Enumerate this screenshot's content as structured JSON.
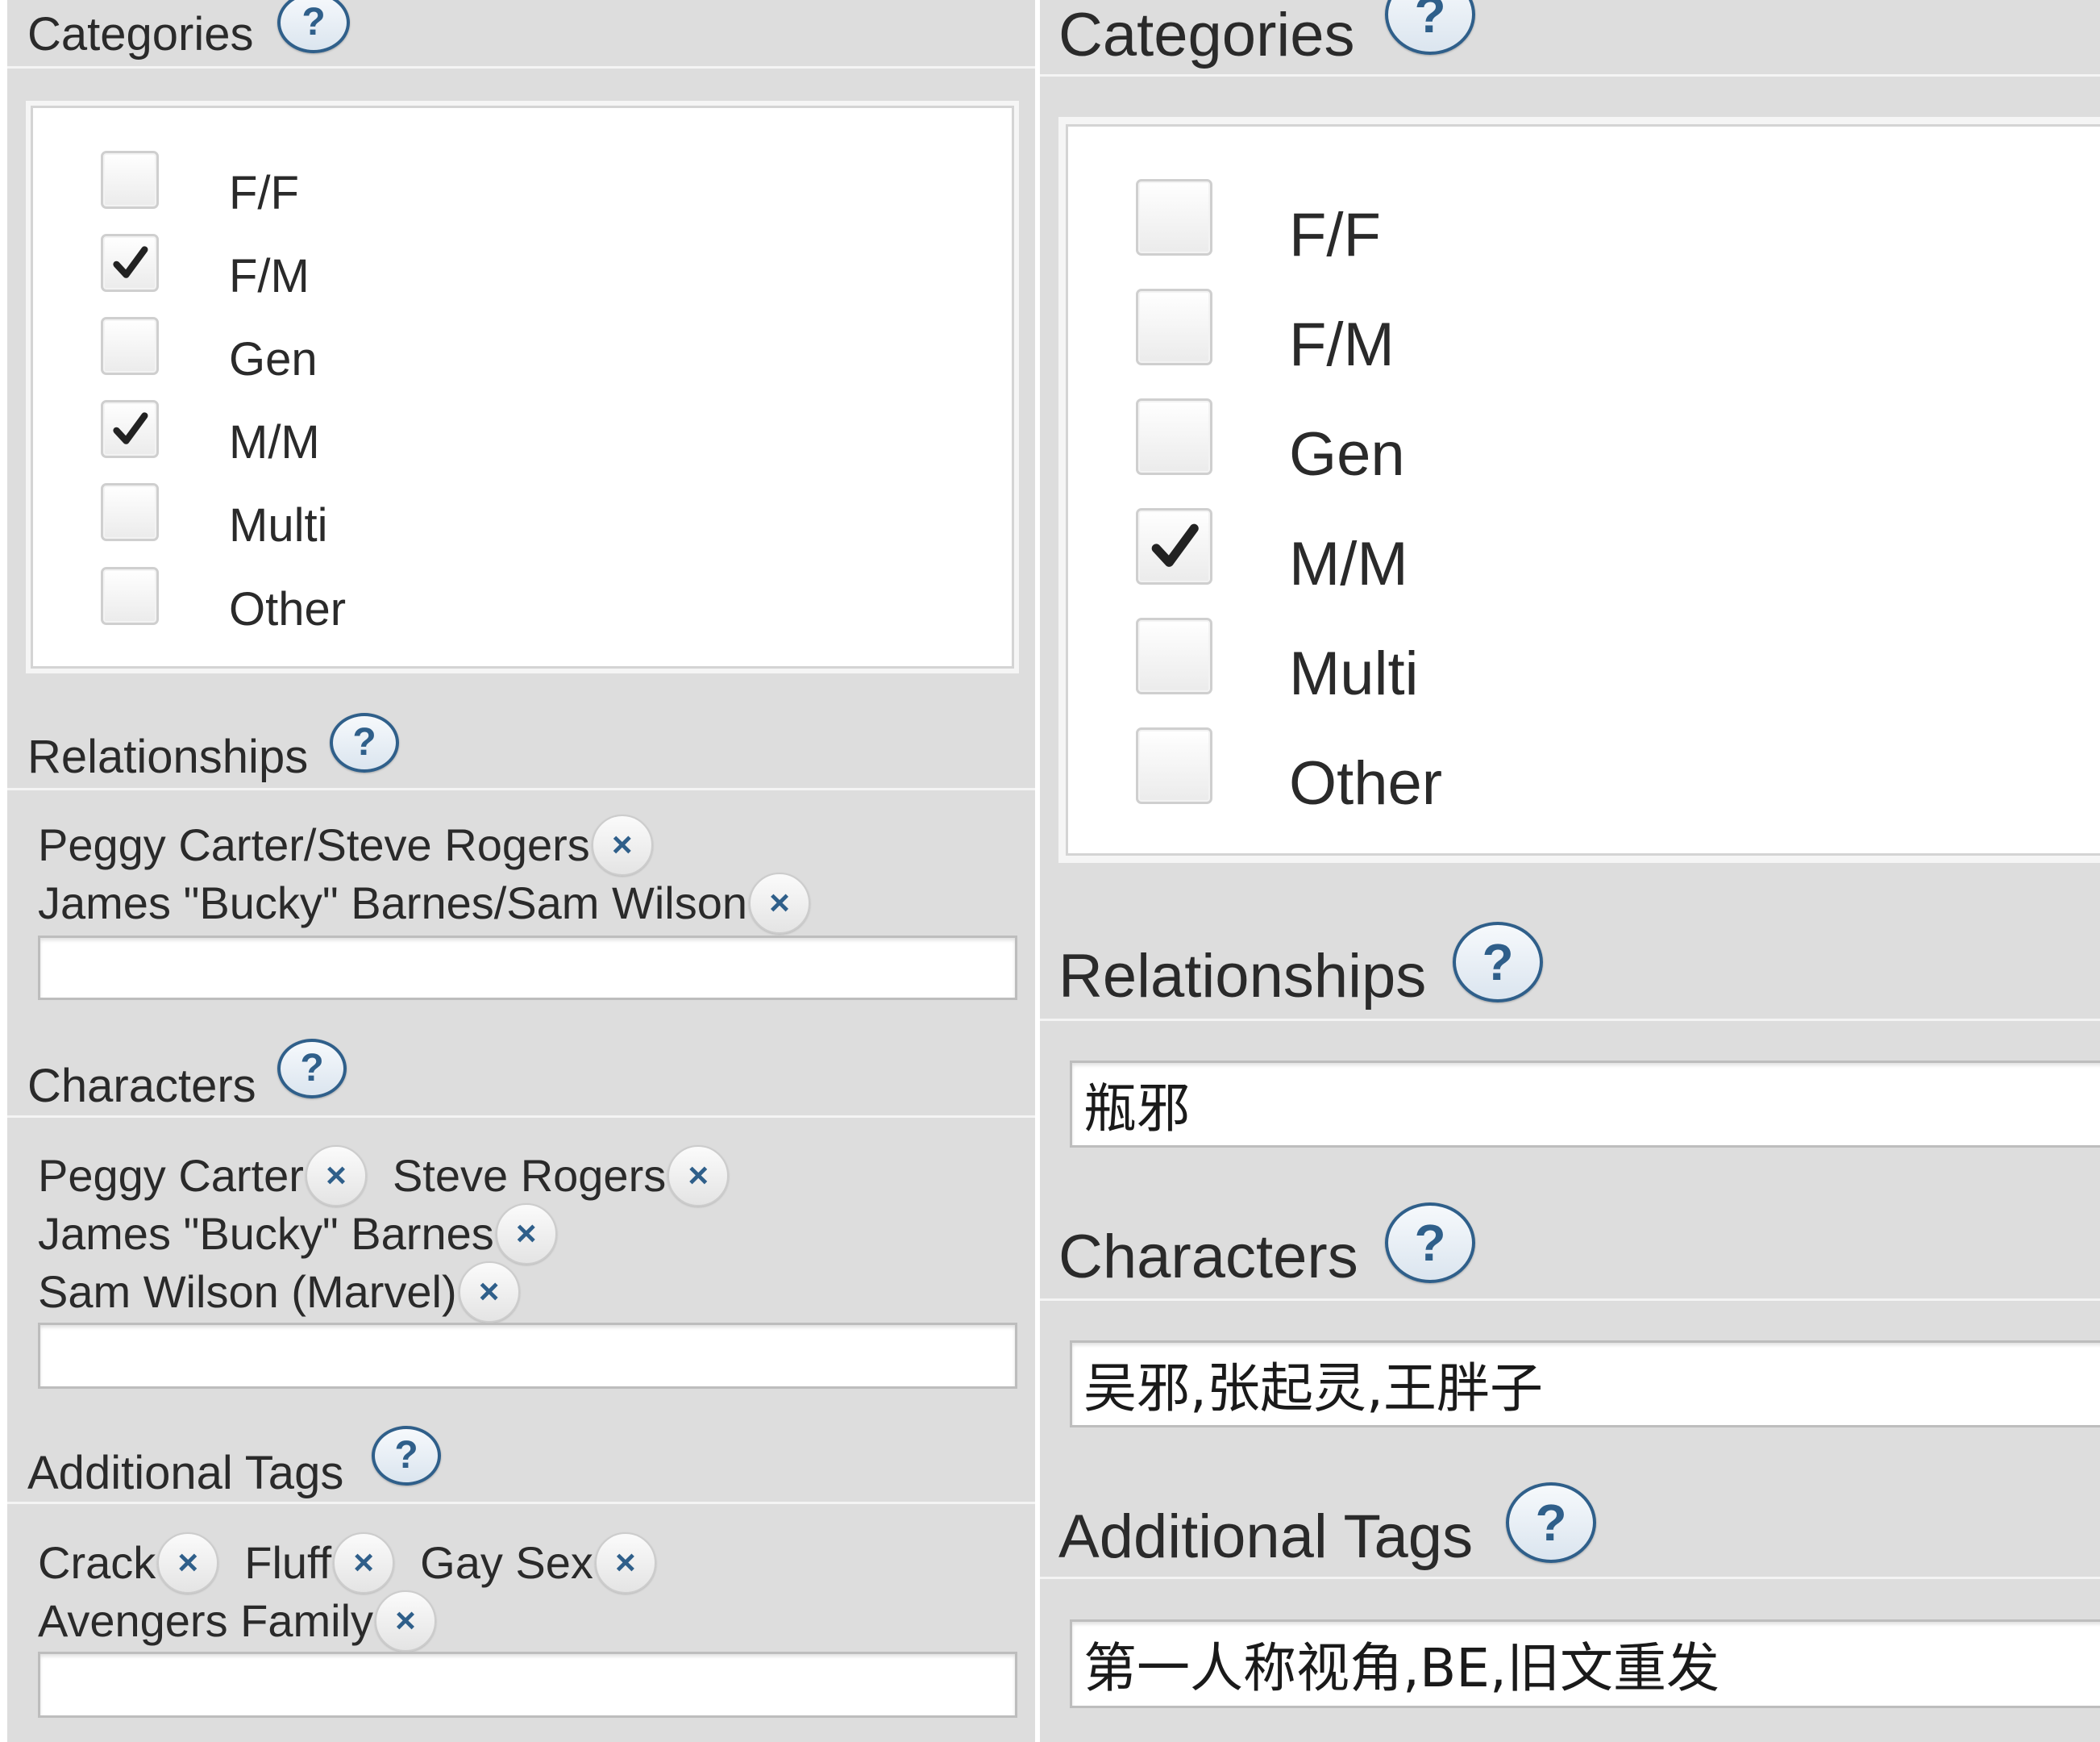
{
  "left": {
    "categories": {
      "title": "Categories",
      "help": "?",
      "options": [
        {
          "label": "F/F",
          "checked": false
        },
        {
          "label": "F/M",
          "checked": true
        },
        {
          "label": "Gen",
          "checked": false
        },
        {
          "label": "M/M",
          "checked": true
        },
        {
          "label": "Multi",
          "checked": false
        },
        {
          "label": "Other",
          "checked": false
        }
      ]
    },
    "relationships": {
      "title": "Relationships",
      "help": "?",
      "tags": [
        "Peggy Carter/Steve Rogers",
        "James \"Bucky\" Barnes/Sam Wilson"
      ],
      "input_value": ""
    },
    "characters": {
      "title": "Characters",
      "help": "?",
      "tags": [
        "Peggy Carter",
        "Steve Rogers",
        "James \"Bucky\" Barnes",
        "Sam Wilson (Marvel)"
      ],
      "input_value": ""
    },
    "additional_tags": {
      "title": "Additional Tags",
      "help": "?",
      "tags": [
        "Crack",
        "Fluff",
        "Gay Sex",
        "Avengers Family"
      ],
      "input_value": ""
    },
    "remove_glyph": "×"
  },
  "right": {
    "categories": {
      "title": "Categories",
      "help": "?",
      "options": [
        {
          "label": "F/F",
          "checked": false
        },
        {
          "label": "F/M",
          "checked": false
        },
        {
          "label": "Gen",
          "checked": false
        },
        {
          "label": "M/M",
          "checked": true
        },
        {
          "label": "Multi",
          "checked": false
        },
        {
          "label": "Other",
          "checked": false
        }
      ]
    },
    "relationships": {
      "title": "Relationships",
      "help": "?",
      "input_value": "瓶邪"
    },
    "characters": {
      "title": "Characters",
      "help": "?",
      "input_value": "吴邪,张起灵,王胖子"
    },
    "additional_tags": {
      "title": "Additional Tags",
      "help": "?",
      "input_value": "第一人称视角,BE,旧文重发"
    }
  },
  "colors": {
    "panel_bg": "#dddddd",
    "help_blue": "#2f5f8a",
    "remove_blue": "#2f5f8a",
    "input_border": "#bdbdbd"
  },
  "icons": {
    "help": "help-circle-icon",
    "remove": "remove-tag-icon",
    "check": "checkmark-icon"
  }
}
